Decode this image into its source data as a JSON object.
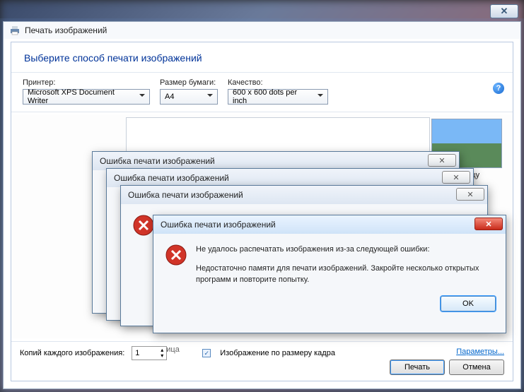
{
  "window": {
    "title": "Печать изображений"
  },
  "header": "Выберите способ печати изображений",
  "labels": {
    "printer": "Принтер:",
    "paper": "Размер бумаги:",
    "quality": "Качество:"
  },
  "selects": {
    "printer": "Microsoft XPS Document Writer",
    "paper": "A4",
    "quality": "600 x 600 dots per inch"
  },
  "thumb_label": "раницу",
  "page_info": "Страница",
  "copies_label": "Копий каждого изображения:",
  "copies_value": "1",
  "fit_label": "Изображение по размеру кадра",
  "params_link": "Параметры...",
  "buttons": {
    "print": "Печать",
    "cancel": "Отмена"
  },
  "error": {
    "title": "Ошибка печати изображений",
    "msg1": "Не удалось распечатать изображения из-за следующей ошибки:",
    "msg2": "Недостаточно памяти для печати изображений. Закройте несколько открытых программ и повторите попытку.",
    "ok": "OK"
  },
  "icons": {
    "close_x": "✕"
  }
}
